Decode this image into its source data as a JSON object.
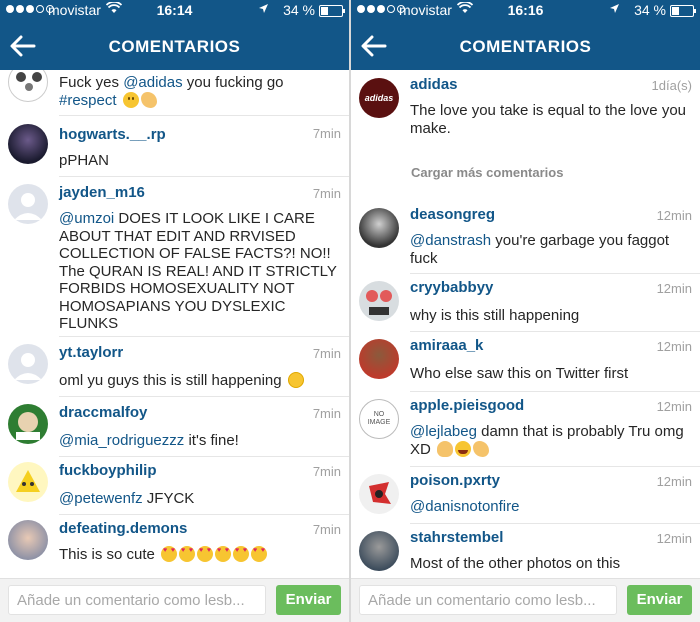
{
  "left": {
    "status": {
      "carrier": "movistar",
      "time": "16:14",
      "battery": "34 %"
    },
    "nav": {
      "title": "COMENTARIOS"
    },
    "top_text_prefix": "Fuck yes ",
    "top_mention": "@adidas",
    "top_text_suffix": " you fucking go",
    "top_text_line2": "#respect",
    "comments": [
      {
        "user": "hogwarts.__.rp",
        "time": "7min",
        "text": "pPHAN"
      },
      {
        "user": "jayden_m16",
        "time": "7min",
        "mention": "@umzoi",
        "text": " DOES IT LOOK LIKE I CARE ABOUT THAT EDIT AND RRVISED COLLECTION OF FALSE FACTS?! NO!! The QURAN IS REAL! AND IT STRICTLY FORBIDS HOMOSEXUALITY NOT HOMOSAPIANS YOU DYSLEXIC FLUNKS"
      },
      {
        "user": "yt.taylorr",
        "time": "7min",
        "text": "oml yu guys this is still happening"
      },
      {
        "user": "draccmalfoy",
        "time": "7min",
        "mention": "@mia_rodriguezzz",
        "text": " it's fine!"
      },
      {
        "user": "fuckboyphilip",
        "time": "7min",
        "mention": "@petewenfz",
        "text": " JFYCK"
      },
      {
        "user": "defeating.demons",
        "time": "7min",
        "text": "This is so cute"
      }
    ],
    "input_placeholder": "Añade un comentario como lesb...",
    "send_label": "Enviar"
  },
  "right": {
    "status": {
      "carrier": "movistar",
      "time": "16:16",
      "battery": "34 %"
    },
    "nav": {
      "title": "COMENTARIOS"
    },
    "caption": {
      "user": "adidas",
      "time": "1día(s)",
      "text": "The love you take is equal to the love you make.",
      "avatar_label": "adidas"
    },
    "load_more": "Cargar más comentarios",
    "comments": [
      {
        "user": "deasongreg",
        "time": "12min",
        "mention": "@danstrash",
        "text": " you're garbage you faggot fuck"
      },
      {
        "user": "cryybabbyy",
        "time": "12min",
        "text": "why is this still happening"
      },
      {
        "user": "amiraaa_k",
        "time": "12min",
        "text": "Who else saw this on Twitter first"
      },
      {
        "user": "apple.pieisgood",
        "time": "12min",
        "mention": "@lejlabeg",
        "text": " damn that is probably Tru omg XD",
        "avatar_label": "NO IMAGE"
      },
      {
        "user": "poison.pxrty",
        "time": "12min",
        "mention": "@danisnotonfire",
        "text": ""
      },
      {
        "user": "stahrstembel",
        "time": "12min",
        "text": "Most of the other photos on this"
      }
    ],
    "input_placeholder": "Añade un comentario como lesb...",
    "send_label": "Enviar"
  },
  "colors": {
    "brand": "#125688",
    "send": "#6bbd5d",
    "time": "#a0a0a0"
  },
  "icons": [
    "back-arrow-icon",
    "wifi-icon",
    "location-arrow-icon",
    "battery-icon",
    "signal-dots-icon"
  ]
}
